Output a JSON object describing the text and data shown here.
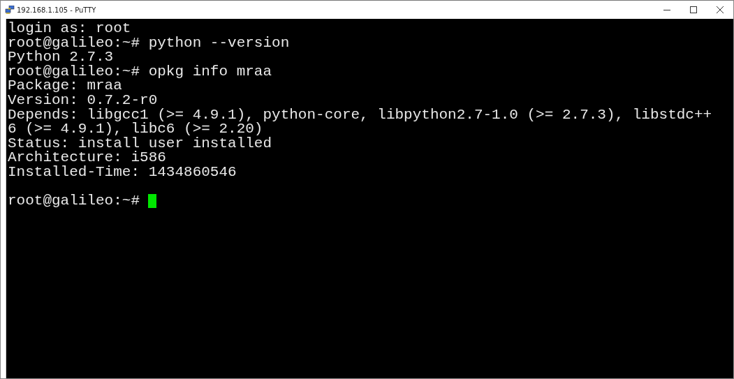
{
  "window": {
    "title": "192.168.1.105 - PuTTY"
  },
  "terminal": {
    "lines": [
      "login as: root",
      "root@galileo:~# python --version",
      "Python 2.7.3",
      "root@galileo:~# opkg info mraa",
      "Package: mraa",
      "Version: 0.7.2-r0",
      "Depends: libgcc1 (>= 4.9.1), python-core, libpython2.7-1.0 (>= 2.7.3), libstdc++",
      "6 (>= 4.9.1), libc6 (>= 2.20)",
      "Status: install user installed",
      "Architecture: i586",
      "Installed-Time: 1434860546"
    ],
    "prompt": {
      "text": "root@galileo:~#",
      "cursor": true
    }
  }
}
